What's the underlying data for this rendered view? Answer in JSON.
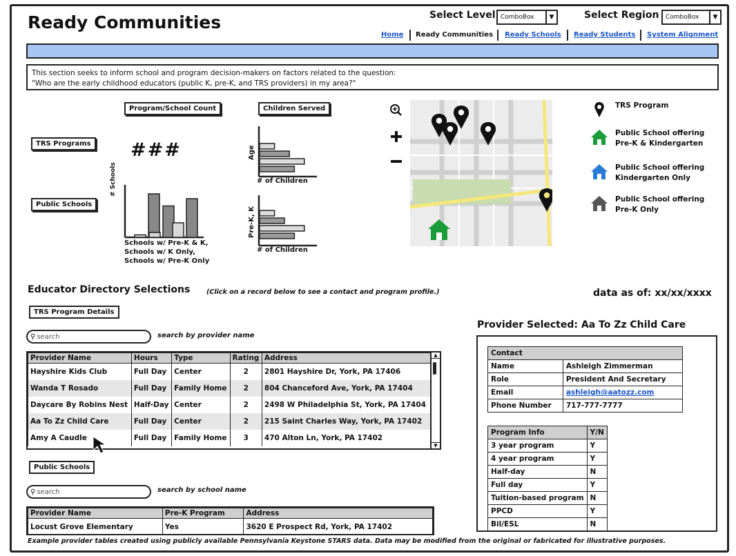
{
  "app": {
    "title": "Ready Communities"
  },
  "header": {
    "select_level_label": "Select Level",
    "select_level_value": "ComboBox",
    "select_region_label": "Select Region",
    "select_region_value": "ComboBox",
    "nav": [
      "Home",
      "Ready Communities",
      "Ready Schools",
      "Ready Students",
      "System Alignment"
    ]
  },
  "intro": {
    "line1": "This section seeks to inform school and program decision-makers on factors related to the question:",
    "line2": "\"Who are the early childhood educators (public K, pre-K, and TRS providers) in my area?\""
  },
  "summary": {
    "count_header": "Program/School Count",
    "children_header": "Children Served",
    "trs_label": "TRS Programs",
    "public_label": "Public Schools",
    "trs_count": "###",
    "schools_ylabel": "# Schools",
    "schools_xlabels": [
      "Schools w/ Pre-K & K,",
      "Schools w/ K Only,",
      "Schools w/ Pre-K Only"
    ],
    "age_ylabel": "Age",
    "prek_ylabel": "Pre-K, K",
    "children_xlabel": "# of Children"
  },
  "chart_data": [
    {
      "type": "bar",
      "title": "Public Schools",
      "ylabel": "# Schools",
      "categories": [
        "Schools w/ Pre-K & K",
        "Schools w/ K Only",
        "Schools w/ Pre-K Only"
      ],
      "series": [
        {
          "values": [
            1,
            18
          ]
        },
        {
          "values": [
            2,
            13
          ]
        },
        {
          "values": [
            6,
            16
          ]
        }
      ]
    },
    {
      "type": "bar",
      "title": "Children Served",
      "ylabel": "Age",
      "xlabel": "# of Children",
      "orientation": "horizontal",
      "values": [
        3,
        6,
        9,
        7
      ]
    },
    {
      "type": "bar",
      "title": "Children Served",
      "ylabel": "Pre-K, K",
      "xlabel": "# of Children",
      "orientation": "horizontal",
      "values": [
        3,
        5,
        9,
        7
      ]
    }
  ],
  "map": {
    "legend": [
      {
        "icon": "pin-icon",
        "label": "TRS Program",
        "color": "#111111"
      },
      {
        "icon": "house-icon",
        "label": "Public School offering Pre-K & Kindergarten",
        "color": "#1a9c3a"
      },
      {
        "icon": "house-icon",
        "label": "Public School offering Kindergarten Only",
        "color": "#2a7ad8"
      },
      {
        "icon": "house-icon",
        "label": "Public School offering Pre-K Only",
        "color": "#555555"
      }
    ]
  },
  "directory": {
    "title": "Educator Directory Selections",
    "hint": "(Click on a record below to see a contact and program profile.)",
    "data_as_of": "data as of: xx/xx/xxxx",
    "trs_tab": "TRS Program Details",
    "search_placeholder": "search",
    "trs_search_hint": "search by provider name",
    "trs_columns": [
      "Provider Name",
      "Hours",
      "Type",
      "Rating",
      "Address"
    ],
    "trs_rows": [
      [
        "Hayshire Kids Club",
        "Full Day",
        "Center",
        "2",
        "2801 Hayshire Dr, York, PA 17406"
      ],
      [
        "Wanda T Rosado",
        "Full Day",
        "Family Home",
        "2",
        "804 Chanceford Ave, York, PA 17404"
      ],
      [
        "Daycare By Robins Nest",
        "Half-Day",
        "Center",
        "2",
        "2498 W Philadelphia St, York, PA 17404"
      ],
      [
        "Aa To Zz Child Care",
        "Full Day",
        "Center",
        "2",
        "215 Saint Charles Way, York, PA 17402"
      ],
      [
        "Amy A Caudle",
        "Full Day",
        "Family Home",
        "3",
        "470 Alton Ln, York, PA 17402"
      ]
    ],
    "public_tab": "Public Schools",
    "public_search_hint": "search by school name",
    "public_columns": [
      "Provider Name",
      "Pre-K Program",
      "Address"
    ],
    "public_rows": [
      [
        "Locust Grove Elementary",
        "Yes",
        "3620 E Prospect Rd, York, PA 17402"
      ]
    ]
  },
  "provider": {
    "title": "Provider Selected: Aa To Zz Child Care",
    "contact_header": "Contact",
    "contact": [
      [
        "Name",
        "Ashleigh Zimmerman"
      ],
      [
        "Role",
        "President And Secretary"
      ],
      [
        "Email",
        "ashleigh@aatozz.com"
      ],
      [
        "Phone Number",
        "717-777-7777"
      ]
    ],
    "program_header": [
      "Program Info",
      "Y/N"
    ],
    "program": [
      [
        "3 year program",
        "Y"
      ],
      [
        "4 year program",
        "Y"
      ],
      [
        "Half-day",
        "N"
      ],
      [
        "Full day",
        "Y"
      ],
      [
        "Tuition-based program",
        "N"
      ],
      [
        "PPCD",
        "Y"
      ],
      [
        "Bil/ESL",
        "N"
      ]
    ]
  },
  "footer": {
    "note": "Example provider tables created using publicly available Pennsylvania Keystone STARS data. Data may be modified from the original or fabricated for illustrative purposes."
  }
}
